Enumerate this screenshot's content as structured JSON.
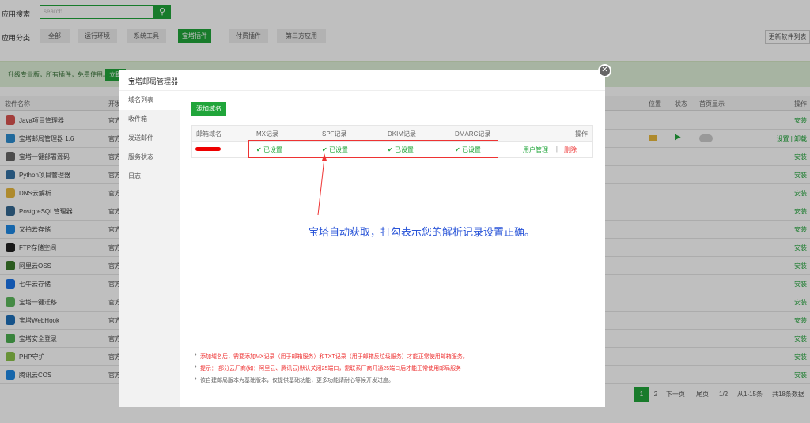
{
  "search": {
    "label": "应用搜索",
    "placeholder": "search",
    "icon": "search-icon"
  },
  "categories": {
    "label": "应用分类",
    "items": [
      "全部",
      "运行环境",
      "系统工具",
      "宝塔插件",
      "付费插件",
      "第三方应用"
    ],
    "active": "宝塔插件"
  },
  "update_button": "更新软件列表",
  "banner": {
    "text": "升级专业版，所有插件，免费使用。",
    "button": "立即"
  },
  "table": {
    "headers": {
      "name": "软件名称",
      "dev": "开发",
      "position": "位置",
      "status": "状态",
      "home": "首页显示",
      "ops": "操作"
    },
    "rows": [
      {
        "name": "Java项目管理器",
        "dev": "官方",
        "op": "安装",
        "color": "#d9534f"
      },
      {
        "name": "宝塔邮局管理器 1.6",
        "dev": "官方",
        "op": "设置 | 卸载",
        "color": "#2d8ccf",
        "installed": true
      },
      {
        "name": "宝塔一键部署源码",
        "dev": "官方",
        "op": "安装",
        "color": "#666"
      },
      {
        "name": "Python项目管理器",
        "dev": "官方",
        "op": "安装",
        "color": "#3572a5"
      },
      {
        "name": "DNS云解析",
        "dev": "官方",
        "op": "安装",
        "color": "#e8b83c"
      },
      {
        "name": "PostgreSQL管理器",
        "dev": "官方",
        "op": "安装",
        "color": "#336791"
      },
      {
        "name": "又拍云存储",
        "dev": "官方",
        "op": "安装",
        "color": "#1e88e5"
      },
      {
        "name": "FTP存储空间",
        "dev": "官方",
        "op": "安装",
        "color": "#222"
      },
      {
        "name": "阿里云OSS",
        "dev": "官方",
        "op": "安装",
        "color": "#3a7a2a"
      },
      {
        "name": "七牛云存储",
        "dev": "官方",
        "op": "安装",
        "color": "#1a73e8"
      },
      {
        "name": "宝塔一键迁移",
        "dev": "官方",
        "op": "安装",
        "color": "#5cb85c"
      },
      {
        "name": "宝塔WebHook",
        "dev": "官方",
        "op": "安装",
        "color": "#1e6fb8"
      },
      {
        "name": "宝塔安全登录",
        "dev": "官方",
        "op": "安装",
        "color": "#4caf50"
      },
      {
        "name": "PHP守护",
        "dev": "官方",
        "op": "安装",
        "color": "#8bc34a"
      },
      {
        "name": "腾讯云COS",
        "dev": "官方",
        "op": "安装",
        "color": "#1e88e5"
      }
    ]
  },
  "pager": {
    "pages": [
      "1",
      "2"
    ],
    "next": "下一页",
    "last": "尾页",
    "ratio": "1/2",
    "range": "从1-15条",
    "total": "共18条数据"
  },
  "modal": {
    "title": "宝塔邮局管理器",
    "nav": [
      "域名列表",
      "收件箱",
      "发送邮件",
      "服务状态",
      "日志"
    ],
    "nav_active": "域名列表",
    "add_button": "添加域名",
    "headers": [
      "邮箱域名",
      "MX记录",
      "SPF记录",
      "DKIM记录",
      "DMARC记录",
      "操作"
    ],
    "row": {
      "records": [
        "已设置",
        "已设置",
        "已设置",
        "已设置"
      ],
      "user_manage": "用户管理",
      "sep": "|",
      "delete": "删除"
    },
    "notes": [
      {
        "text": "添加域名后，需要添加MX记录（用于邮箱服务）和TXT记录（用于邮箱反垃圾服务）才能正常使用邮箱服务。",
        "color": "#e33"
      },
      {
        "text": "提示： 部分云厂商(如：阿里云、腾讯云)默认关闭25端口，需联系厂商开通25端口后才能正常使用邮局服务",
        "color": "#e33"
      },
      {
        "text": "该自建邮局版本为基础版本，仅提供基础功能，更多功能请耐心等候开发进度。",
        "color": "#666"
      }
    ]
  },
  "annotation": "宝塔自动获取，打勾表示您的解析记录设置正确。",
  "colors": {
    "accent": "#20a53a",
    "danger": "#e33",
    "annotation": "#2a55d8"
  }
}
